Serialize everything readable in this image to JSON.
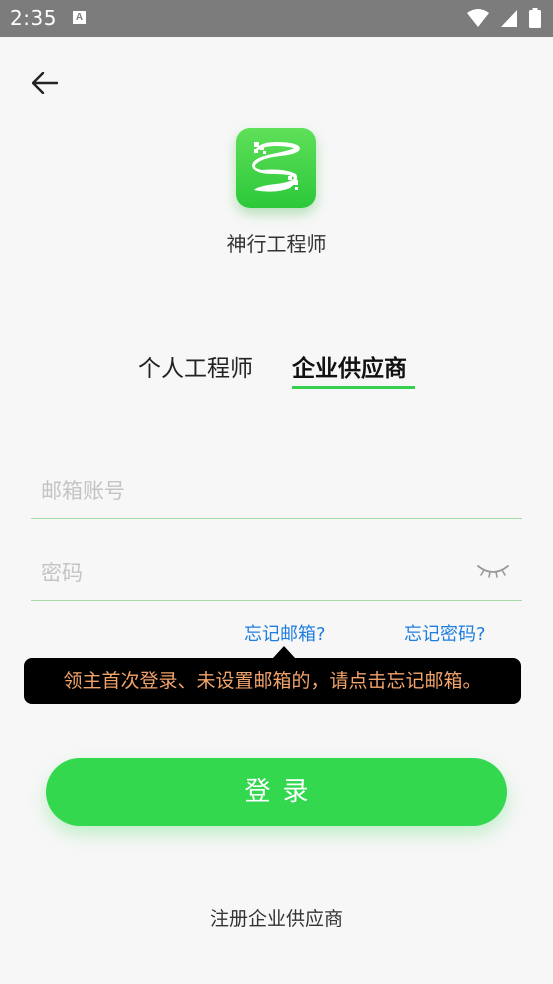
{
  "status_bar": {
    "time": "2:35",
    "notification_icon": "A"
  },
  "icons": {
    "back": "arrow-left-icon",
    "wifi": "wifi-icon",
    "signal": "cell-signal-icon",
    "battery": "battery-icon",
    "eye": "eye-closed-icon"
  },
  "app": {
    "name": "神行工程师"
  },
  "tabs": [
    {
      "label": "个人工程师",
      "active": false
    },
    {
      "label": "企业供应商",
      "active": true
    }
  ],
  "form": {
    "email_placeholder": "邮箱账号",
    "password_placeholder": "密码"
  },
  "links": {
    "forgot_email": "忘记邮箱?",
    "forgot_password": "忘记密码?"
  },
  "tooltip": {
    "text": "领主首次登录、未设置邮箱的，请点击忘记邮箱。"
  },
  "login_button": "登录",
  "register_link": "注册企业供应商",
  "colors": {
    "accent_green": "#33d84f",
    "link_blue": "#1d7ee0",
    "tooltip_text": "#f2a36b",
    "status_bar": "#7c7c7c"
  }
}
